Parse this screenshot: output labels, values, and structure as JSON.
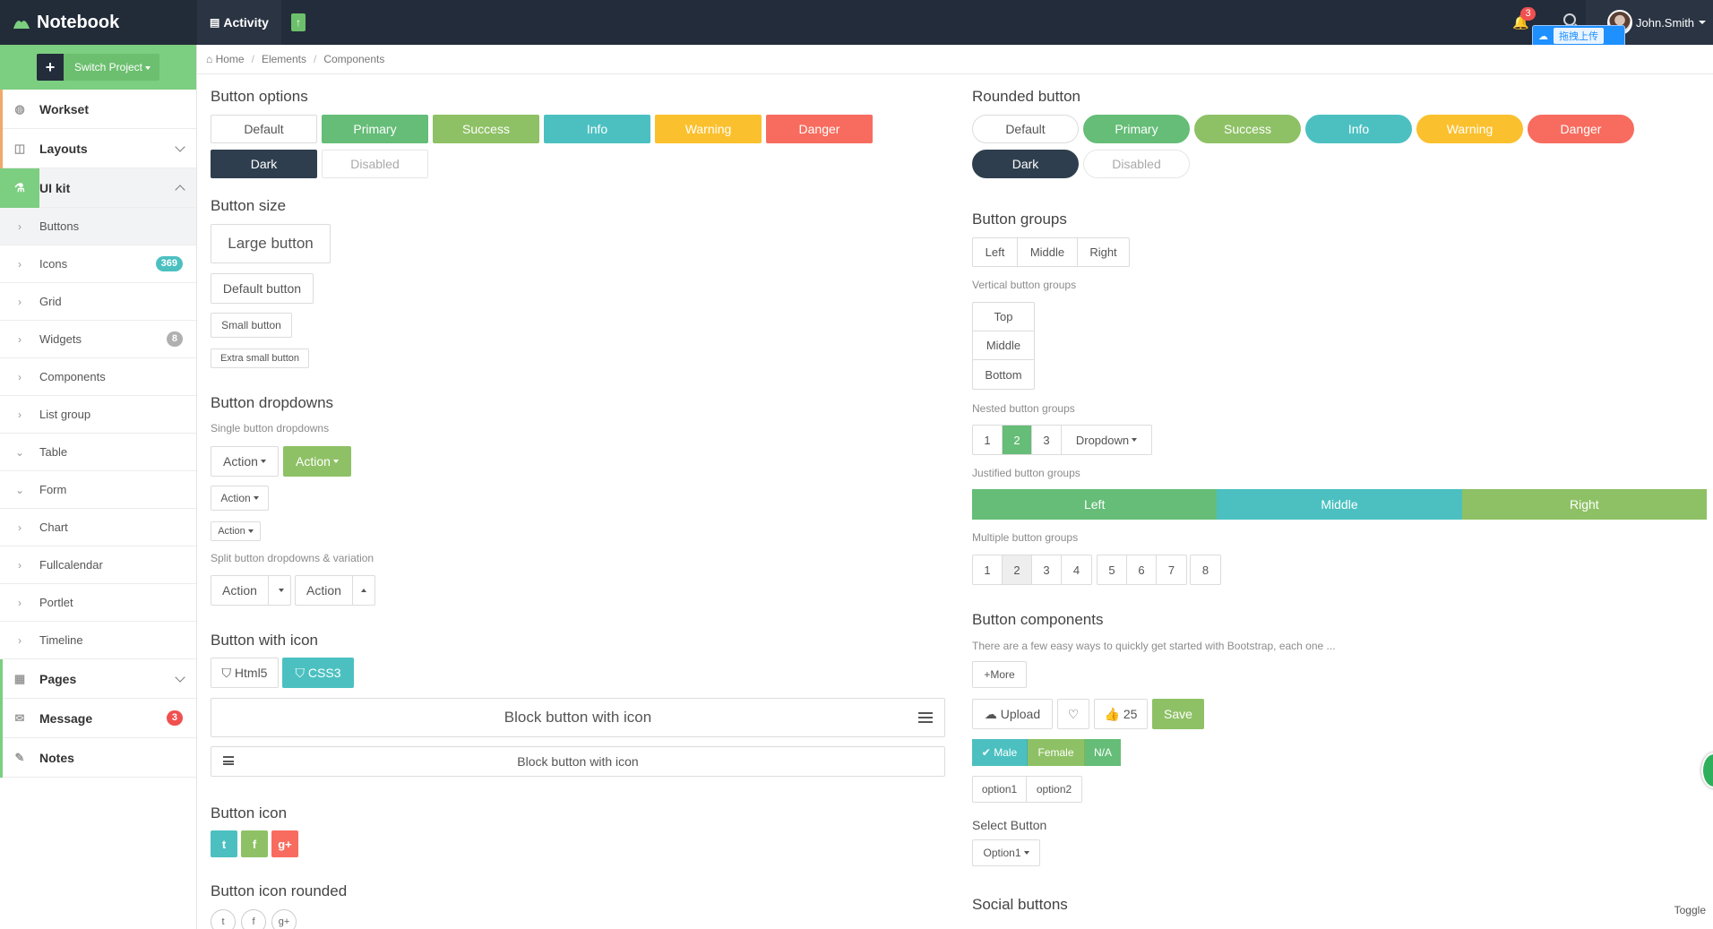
{
  "brand": {
    "name": "Notebook"
  },
  "topnav": {
    "activity": "Activity",
    "notif_count": "3",
    "user": "John.Smith",
    "upload_widget": "拖拽上传"
  },
  "sidebar": {
    "switch_label": "Switch Project",
    "main_items": [
      {
        "label": "Workset",
        "icon": "dashboard-icon"
      },
      {
        "label": "Layouts",
        "icon": "columns-icon"
      },
      {
        "label": "UI kit",
        "icon": "flask-icon"
      }
    ],
    "sub_items": [
      {
        "label": "Buttons"
      },
      {
        "label": "Icons",
        "badge": "369"
      },
      {
        "label": "Grid"
      },
      {
        "label": "Widgets",
        "badge": "8"
      },
      {
        "label": "Components"
      },
      {
        "label": "List group"
      },
      {
        "label": "Table"
      },
      {
        "label": "Form"
      },
      {
        "label": "Chart"
      },
      {
        "label": "Fullcalendar"
      },
      {
        "label": "Portlet"
      },
      {
        "label": "Timeline"
      }
    ],
    "bottom_items": [
      {
        "label": "Pages"
      },
      {
        "label": "Message",
        "badge": "3"
      },
      {
        "label": "Notes"
      }
    ]
  },
  "breadcrumb": [
    "Home",
    "Elements",
    "Components"
  ],
  "left": {
    "options_title": "Button options",
    "option_buttons": [
      "Default",
      "Primary",
      "Success",
      "Info",
      "Warning",
      "Danger",
      "Dark",
      "Disabled"
    ],
    "size_title": "Button size",
    "size_buttons": [
      "Large button",
      "Default button",
      "Small button",
      "Extra small button"
    ],
    "dropdowns_title": "Button dropdowns",
    "single_sub": "Single button dropdowns",
    "action": "Action",
    "split_sub": "Split button dropdowns & variation",
    "with_icon_title": "Button with icon",
    "html5": "Html5",
    "css3": "CSS3",
    "block_icon": "Block button with icon",
    "icon_title": "Button icon",
    "icon_rounded_title": "Button icon rounded"
  },
  "right": {
    "rounded_title": "Rounded button",
    "groups_title": "Button groups",
    "hgroup": [
      "Left",
      "Middle",
      "Right"
    ],
    "vertical_sub": "Vertical button groups",
    "vgroup": [
      "Top",
      "Middle",
      "Bottom"
    ],
    "nested_sub": "Nested button groups",
    "nested": [
      "1",
      "2",
      "3"
    ],
    "dropdown": "Dropdown",
    "justified_sub": "Justified button groups",
    "justified": [
      "Left",
      "Middle",
      "Right"
    ],
    "multiple_sub": "Multiple button groups",
    "multiple_a": [
      "1",
      "2",
      "3",
      "4"
    ],
    "multiple_b": [
      "5",
      "6",
      "7"
    ],
    "multiple_c": [
      "8"
    ],
    "components_title": "Button components",
    "components_desc": "There are a few easy ways to quickly get started with Bootstrap, each one ...",
    "more": "More",
    "upload": "Upload",
    "likes": "25",
    "save": "Save",
    "gender": [
      "Male",
      "Female",
      "N/A"
    ],
    "options": [
      "option1",
      "option2"
    ],
    "select_label": "Select Button",
    "select_value": "Option1",
    "social_title": "Social buttons"
  },
  "toggle": "Toggle",
  "colors": {
    "primary": "#65bd77",
    "success": "#8ec165",
    "info": "#4cc0c1",
    "warning": "#fbc02d",
    "danger": "#f76c5e",
    "dark": "#2e3e4e",
    "sidebar_accent": "#7cce80"
  }
}
